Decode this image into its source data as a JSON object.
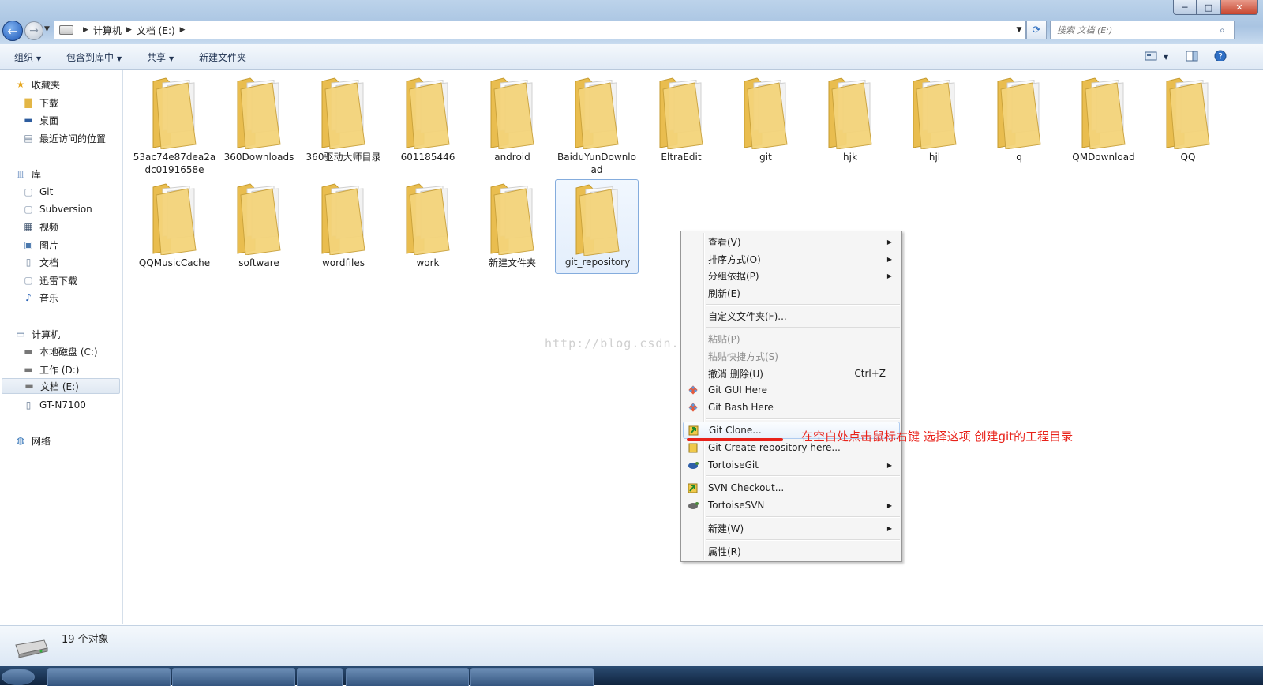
{
  "window": {
    "controls": {
      "minimize": "─",
      "maximize": "□",
      "close": "✕"
    }
  },
  "address": {
    "crumbs": [
      "计算机",
      "文档 (E:)"
    ],
    "search_placeholder": "搜索 文档 (E:)"
  },
  "toolbar": {
    "organize": "组织",
    "include_in_library": "包含到库中",
    "share": "共享",
    "new_folder": "新建文件夹"
  },
  "sidebar": {
    "favorites": {
      "label": "收藏夹",
      "items": [
        "下载",
        "桌面",
        "最近访问的位置"
      ]
    },
    "libraries": {
      "label": "库",
      "items": [
        "Git",
        "Subversion",
        "视频",
        "图片",
        "文档",
        "迅雷下载",
        "音乐"
      ]
    },
    "computer": {
      "label": "计算机",
      "items": [
        "本地磁盘 (C:)",
        "工作 (D:)",
        "文档 (E:)",
        "GT-N7100"
      ]
    },
    "network": {
      "label": "网络"
    }
  },
  "folders": [
    "53ac74e87dea2adc0191658e",
    "360Downloads",
    "360驱动大师目录",
    "601185446",
    "android",
    "BaiduYunDownload",
    "EltraEdit",
    "git",
    "hjk",
    "hjl",
    "q",
    "QMDownload",
    "QQ",
    "QQMusicCache",
    "software",
    "wordfiles",
    "work",
    "新建文件夹",
    "git_repository"
  ],
  "watermark": "http://blog.csdn.net/",
  "context_menu": {
    "view": "查看(V)",
    "sort_by": "排序方式(O)",
    "group_by": "分组依据(P)",
    "refresh": "刷新(E)",
    "customize": "自定义文件夹(F)...",
    "paste": "粘贴(P)",
    "paste_shortcut": "粘贴快捷方式(S)",
    "undo_delete": "撤消 删除(U)",
    "undo_shortcut": "Ctrl+Z",
    "git_gui": "Git GUI Here",
    "git_bash": "Git Bash Here",
    "git_clone": "Git Clone...",
    "git_create_repo": "Git Create repository here...",
    "tortoisegit": "TortoiseGit",
    "svn_checkout": "SVN Checkout...",
    "tortoisesvn": "TortoiseSVN",
    "new": "新建(W)",
    "properties": "属性(R)"
  },
  "annotation": "在空白处点击鼠标右键 选择这项 创建git的工程目录",
  "status": {
    "count": "19 个对象"
  },
  "colors": {
    "annotation": "#e8221a",
    "folder": "#f4d47a",
    "selection": "#84acdd"
  }
}
